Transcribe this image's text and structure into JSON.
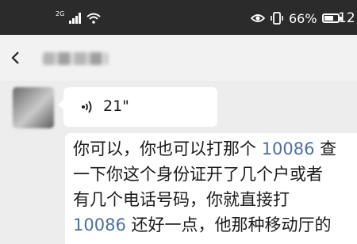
{
  "status_bar": {
    "network_type": "2G",
    "battery_percent": "66%",
    "battery_level": 0.66,
    "clock": "12"
  },
  "nav": {
    "title": ""
  },
  "messages": {
    "voice": {
      "duration": "21\""
    },
    "text": {
      "lines": [
        {
          "before": "你可以，你也可以打那个 ",
          "phone": "10086",
          "after": " 查"
        },
        {
          "before": "一下你这个身份证开了几个户或者",
          "phone": "",
          "after": ""
        },
        {
          "before": "有几个电话号码，你就直接打",
          "phone": "",
          "after": ""
        },
        {
          "before": "",
          "phone": "10086",
          "after": " 还好一点，他那种移动厅的"
        }
      ]
    }
  },
  "colors": {
    "background": "#ededed",
    "status_bar": "#2b2b2b",
    "bubble": "#ffffff",
    "link": "#4a6fa5"
  }
}
